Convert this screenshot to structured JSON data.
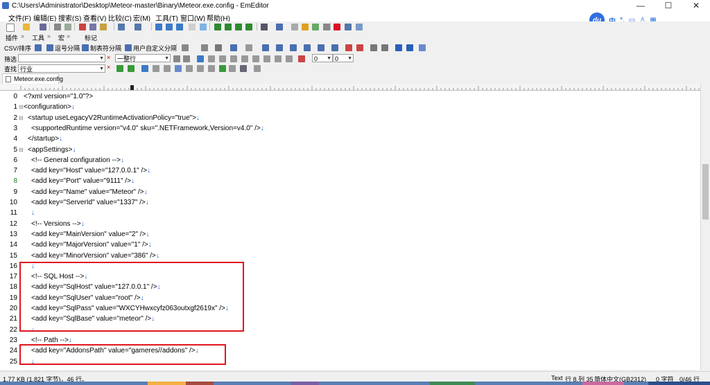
{
  "window": {
    "title": "C:\\Users\\Administrator\\Desktop\\Meteor-master\\Binary\\Meteor.exe.config - EmEditor",
    "minimize_glyph": "—",
    "maximize_glyph": "☐",
    "close_glyph": "✕"
  },
  "menu": [
    "文件(F)",
    "编辑(E)",
    "搜索(S)",
    "查看(V)",
    "比较(C)",
    "宏(M)",
    "工具(T)",
    "窗口(W)",
    "帮助(H)"
  ],
  "ime": {
    "logo": "du",
    "mode": "中",
    "punct": "°,"
  },
  "toolbar2": [
    "插件",
    "工具",
    "宏",
    "标记"
  ],
  "toolbar3": {
    "csv": "CSV/排序",
    "b1": "逗号分隔",
    "b2": "制表符分隔",
    "b3": "用户自定义分隔"
  },
  "filter": {
    "label": "筛选",
    "value": "",
    "mode": "一整行"
  },
  "find": {
    "label": "查找",
    "value": "行业"
  },
  "dropdown_zero_a": "0",
  "dropdown_zero_b": "0",
  "tab": {
    "label": "Meteor.exe.config"
  },
  "lines": [
    {
      "n": "0",
      "text": "<?xml version=\"1.0\"?>",
      "indent": 0
    },
    {
      "n": "1",
      "text": "<configuration>",
      "indent": 0
    },
    {
      "n": "2",
      "text": "<startup useLegacyV2RuntimeActivationPolicy=\"true\">",
      "indent": 1
    },
    {
      "n": "3",
      "text": "<supportedRuntime version=\"v4.0\" sku=\".NETFramework,Version=v4.0\" />",
      "indent": 2
    },
    {
      "n": "4",
      "text": "</startup>",
      "indent": 1
    },
    {
      "n": "5",
      "text": "<appSettings>",
      "indent": 1
    },
    {
      "n": "6",
      "text": "<!-- General configuration -->",
      "indent": 2
    },
    {
      "n": "7",
      "text": "<add key=\"Host\" value=\"127.0.0.1\" />",
      "indent": 2
    },
    {
      "n": "8",
      "text": "<add key=\"Port\" value=\"9111\" />",
      "indent": 2
    },
    {
      "n": "9",
      "text": "<add key=\"Name\" value=\"Meteor\" />",
      "indent": 2
    },
    {
      "n": "10",
      "text": "<add key=\"ServerId\" value=\"1337\" />",
      "indent": 2
    },
    {
      "n": "11",
      "text": "",
      "indent": 2
    },
    {
      "n": "12",
      "text": "<!-- Versions -->",
      "indent": 2
    },
    {
      "n": "13",
      "text": "<add key=\"MainVersion\" value=\"2\" />",
      "indent": 2
    },
    {
      "n": "14",
      "text": "<add key=\"MajorVersion\" value=\"1\" />",
      "indent": 2
    },
    {
      "n": "15",
      "text": "<add key=\"MinorVersion\" value=\"386\" />",
      "indent": 2
    },
    {
      "n": "16",
      "text": "",
      "indent": 2
    },
    {
      "n": "17",
      "text": "<!-- SQL Host -->",
      "indent": 2
    },
    {
      "n": "18",
      "text": "<add key=\"SqlHost\" value=\"127.0.0.1\" />",
      "indent": 2
    },
    {
      "n": "19",
      "text": "<add key=\"SqlUser\" value=\"root\" />",
      "indent": 2
    },
    {
      "n": "20",
      "text": "<add key=\"SqlPass\" value=\"WXCYHwxcyfz063outxgf2619x\" />",
      "indent": 2
    },
    {
      "n": "21",
      "text": "<add key=\"SqlBase\" value=\"meteor\" />",
      "indent": 2
    },
    {
      "n": "22",
      "text": "",
      "indent": 2
    },
    {
      "n": "23",
      "text": "<!-- Path -->",
      "indent": 2
    },
    {
      "n": "24",
      "text": "<add key=\"AddonsPath\" value=\"gameres//addons\" />",
      "indent": 2
    },
    {
      "n": "25",
      "text": "",
      "indent": 2
    }
  ],
  "eol_glyph": "↓",
  "status": {
    "size": "1.77 KB (1,821 字节)，46 行。",
    "mode": "Text",
    "position": "行 8,列 35",
    "encoding": "简体中文(GB2312)",
    "chars": "0 字符",
    "lines_ratio": "0/46 行"
  },
  "colors": {
    "highlight_box": "#e0161e",
    "eol": "#1a5fd6",
    "current_line_number": "#1d7a1d"
  }
}
